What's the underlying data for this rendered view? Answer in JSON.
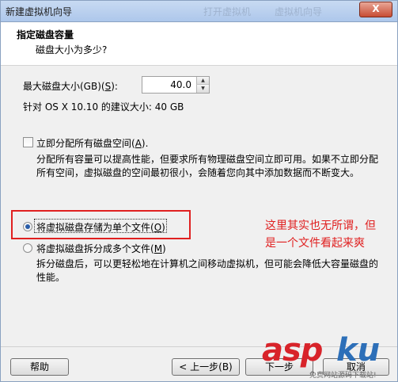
{
  "window": {
    "title": "新建虚拟机向导",
    "title_ghosts": [
      "打开虚拟机",
      "虚拟机向导"
    ],
    "close_label": "X"
  },
  "header": {
    "title": "指定磁盘容量",
    "subtitle": "磁盘大小为多少?"
  },
  "disk_size": {
    "label": "最大磁盘大小(GB)(",
    "label_key": "S",
    "label_end": "):",
    "value": "40.0",
    "recommend": "针对 OS X 10.10 的建议大小: 40 GB"
  },
  "allocate": {
    "label": "立即分配所有磁盘空间(",
    "label_key": "A",
    "label_end": ").",
    "desc_line1": "分配所有容量可以提高性能，但要求所有物理磁盘空间立即可用。如果不立即分配",
    "desc_line2": "所有空间，虚拟磁盘的空间最初很小，会随着您向其中添加数据而不断变大。"
  },
  "single_file": {
    "label": "将虚拟磁盘存储为单个文件(",
    "label_key": "O",
    "label_end": ")",
    "checked": true
  },
  "multi_file": {
    "label": "将虚拟磁盘拆分成多个文件(",
    "label_key": "M",
    "label_end": ")",
    "checked": false,
    "desc_line1": "拆分磁盘后，可以更轻松地在计算机之间移动虚拟机，但可能会降低大容量磁盘的",
    "desc_line2": "性能。"
  },
  "annotation": {
    "line1": "这里其实也无所谓，但",
    "line2": "是一个文件看起来爽",
    "color": "#e02020"
  },
  "footer": {
    "help": "帮助",
    "back": "< 上一步(B)",
    "next": "下一步",
    "cancel": "取消"
  },
  "watermark": {
    "part1": "asp",
    "part2": "ku",
    "sub": "免费网站源码下载站!"
  }
}
